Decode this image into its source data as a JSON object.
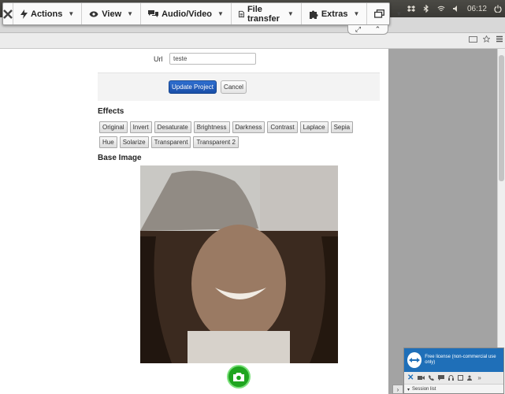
{
  "system_tray": {
    "time": "06:12"
  },
  "teamviewer_toolbar": {
    "actions_label": "Actions",
    "view_label": "View",
    "audio_video_label": "Audio/Video",
    "file_transfer_label": "File transfer",
    "extras_label": "Extras"
  },
  "form": {
    "url_label": "Url",
    "url_value": "teste",
    "update_button": "Update Project",
    "cancel_button": "Cancel"
  },
  "effects": {
    "heading": "Effects",
    "buttons": [
      "Original",
      "Invert",
      "Desaturate",
      "Brightness",
      "Darkness",
      "Contrast",
      "Laplace",
      "Sepia",
      "Hue",
      "Solarize",
      "Transparent",
      "Transparent 2"
    ]
  },
  "base_image": {
    "heading": "Base Image"
  },
  "teamviewer_panel": {
    "license_text": "Free license (non-commercial use only)",
    "session_list": "Session list"
  },
  "colors": {
    "primary_button": "#1f5bbd",
    "camera_button": "#1fa51f",
    "teamviewer_blue": "#1f6fb8"
  }
}
